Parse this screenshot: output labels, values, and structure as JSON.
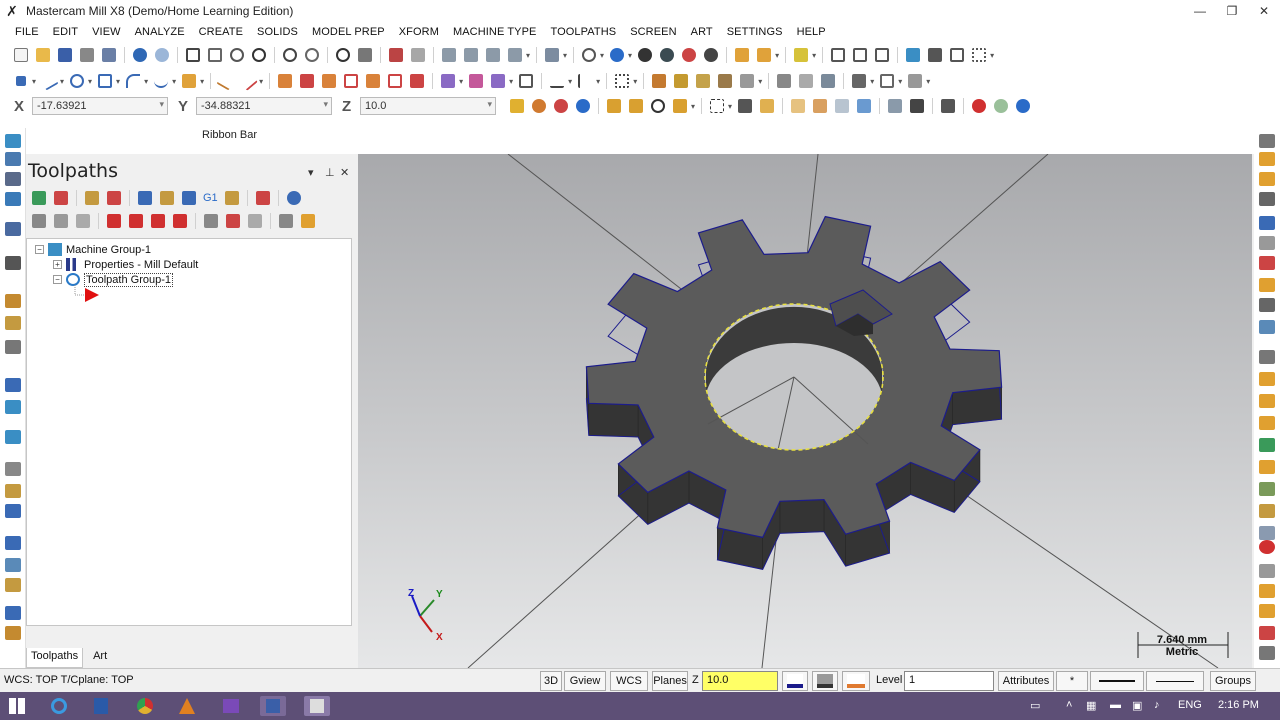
{
  "window": {
    "title": "Mastercam Mill X8 (Demo/Home Learning Edition)",
    "controls": [
      "—",
      "❐",
      "✕"
    ]
  },
  "menu": [
    "FILE",
    "EDIT",
    "VIEW",
    "ANALYZE",
    "CREATE",
    "SOLIDS",
    "MODEL PREP",
    "XFORM",
    "MACHINE TYPE",
    "TOOLPATHS",
    "SCREEN",
    "ART",
    "SETTINGS",
    "HELP"
  ],
  "coordinates": {
    "x_label": "X",
    "x_value": "-17.63921",
    "y_label": "Y",
    "y_value": "-34.88321",
    "z_label": "Z",
    "z_value": "10.0"
  },
  "ribbon_bar": {
    "label": "Ribbon Bar"
  },
  "toolpaths_panel": {
    "title": "Toolpaths",
    "controls": [
      "▾",
      "⊥",
      "✕"
    ],
    "tree": {
      "machine_group": "Machine Group-1",
      "properties": "Properties - Mill Default",
      "toolpath_group": "Toolpath Group-1"
    },
    "toolbar_text_g1": "G1",
    "tabs": [
      "Toolpaths",
      "Art"
    ]
  },
  "viewport": {
    "scale_value": "7.640 mm",
    "scale_unit": "Metric",
    "axis_labels": {
      "x": "X",
      "y": "Y",
      "z": "Z"
    }
  },
  "status": {
    "wcs_text": "WCS: TOP  T/Cplane: TOP",
    "btn_3d": "3D",
    "btn_gview": "Gview",
    "btn_wcs": "WCS",
    "btn_planes": "Planes",
    "z_label": "Z",
    "z_value": "10.0",
    "level_label": "Level",
    "level_value": "1",
    "btn_attributes": "Attributes",
    "point_style": "*",
    "btn_groups": "Groups"
  },
  "taskbar": {
    "language": "ENG",
    "time": "2:16 PM"
  },
  "colors": {
    "viewport_top": "#a8a9ac",
    "viewport_bottom": "#e6e7e8",
    "gear_face": "#5b5b5b",
    "gear_side": "#343434",
    "gear_edge": "#1c1c8c",
    "selection_chain": "#e8e040",
    "taskbar": "#5d4f76",
    "z_field": "#ffff66"
  }
}
